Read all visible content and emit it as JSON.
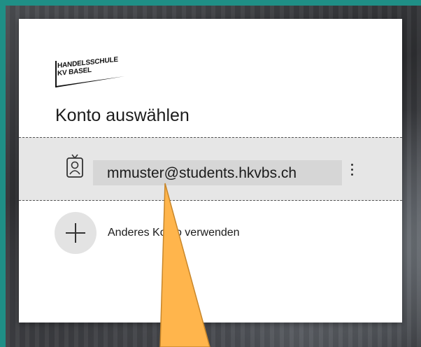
{
  "logo": {
    "line1": "HANDELSSCHULE",
    "line2": "KV BASEL"
  },
  "dialog": {
    "title": "Konto auswählen"
  },
  "account": {
    "email": "mmuster@students.hkvbs.ch"
  },
  "other_account": {
    "label": "Anderes Konto verwenden"
  },
  "colors": {
    "frame": "#1f8f86",
    "selected_row": "#e6e6e6",
    "annotation_arrow": "#ffb54c"
  }
}
